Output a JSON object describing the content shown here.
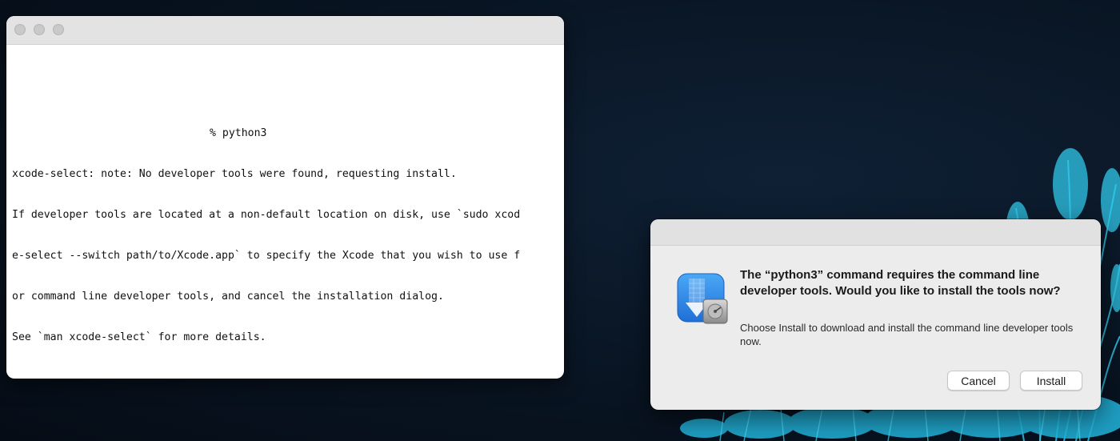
{
  "terminal": {
    "prompt": "% python3",
    "output_lines": [
      "xcode-select: note: No developer tools were found, requesting install.",
      "If developer tools are located at a non-default location on disk, use `sudo xcod",
      "e-select --switch path/to/Xcode.app` to specify the Xcode that you wish to use f",
      "or command line developer tools, and cancel the installation dialog.",
      "See `man xcode-select` for more details."
    ]
  },
  "dialog": {
    "heading": "The “python3” command requires the command line developer tools. Would you like to install the tools now?",
    "message": "Choose Install to download and install the command line developer tools now.",
    "cancel_label": "Cancel",
    "install_label": "Install",
    "icon": "xcode-installer-icon"
  },
  "colors": {
    "accent_blue": "#2f7fe0",
    "wallpaper": "#0a1726",
    "grass": "#29c4e8"
  }
}
